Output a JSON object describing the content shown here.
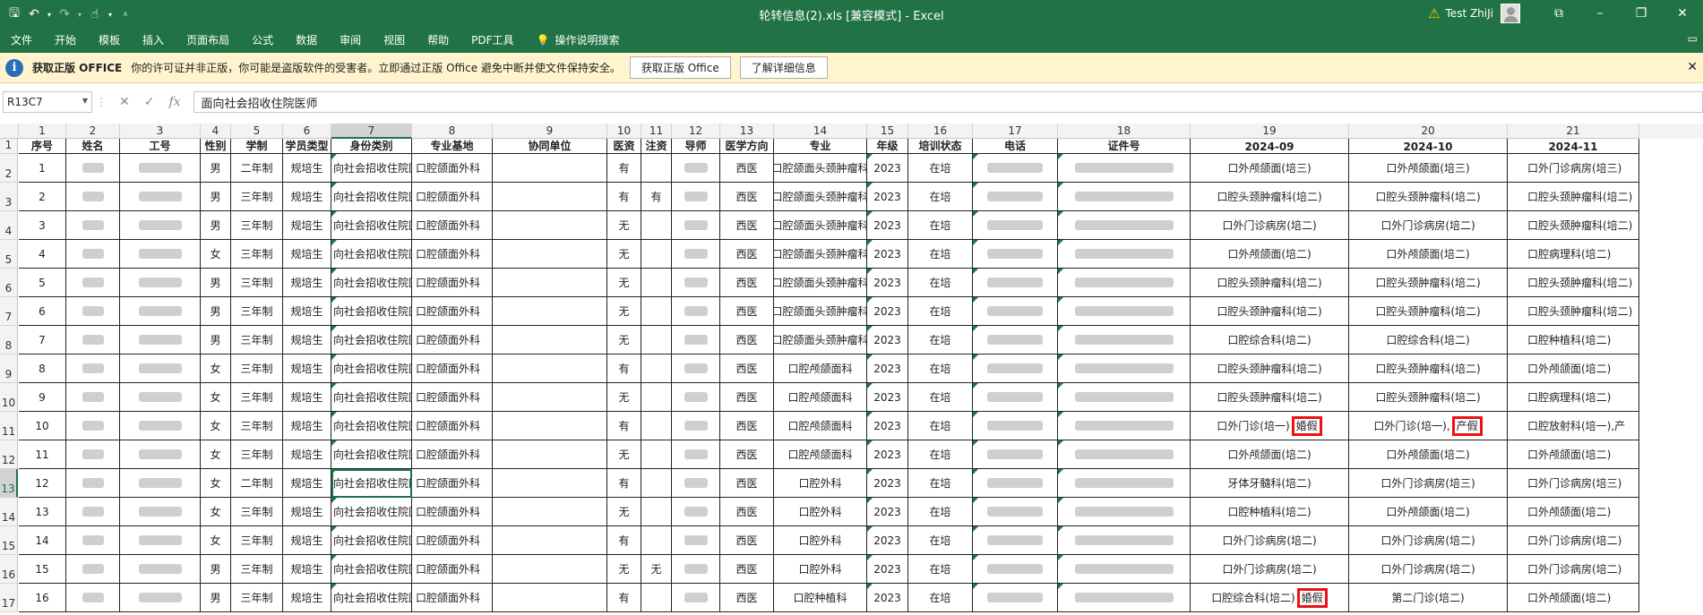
{
  "app": {
    "title": "轮转信息(2).xls  [兼容模式]  -  Excel",
    "user": "Test ZhiJi"
  },
  "ribbon": {
    "tabs": [
      "文件",
      "开始",
      "模板",
      "插入",
      "页面布局",
      "公式",
      "数据",
      "审阅",
      "视图",
      "帮助",
      "PDF工具"
    ],
    "tell_me": "操作说明搜索"
  },
  "message_bar": {
    "title": "获取正版 OFFICE",
    "text": "你的许可证并非正版，你可能是盗版软件的受害者。立即通过正版 Office 避免中断并使文件保持安全。",
    "button1": "获取正版 Office",
    "button2": "了解详细信息"
  },
  "formula_bar": {
    "name_box": "R13C7",
    "formula": "面向社会招收住院医师"
  },
  "sheet": {
    "column_numbers": [
      "1",
      "2",
      "3",
      "4",
      "5",
      "6",
      "7",
      "8",
      "9",
      "10",
      "11",
      "12",
      "13",
      "14",
      "15",
      "16",
      "17",
      "18",
      "19",
      "20",
      "21"
    ],
    "selected_column": "7",
    "selected_row": "13",
    "headers": [
      "序号",
      "姓名",
      "工号",
      "性别",
      "学制",
      "学员类型",
      "身份类别",
      "专业基地",
      "协同单位",
      "医资",
      "注资",
      "导师",
      "医学方向",
      "专业",
      "年级",
      "培训状态",
      "电话",
      "证件号",
      "2024-09",
      "2024-10",
      "2024-11"
    ],
    "row_numbers": [
      "1",
      "2",
      "3",
      "4",
      "5",
      "6",
      "7",
      "8",
      "9",
      "10",
      "11",
      "12",
      "13",
      "14",
      "15",
      "16",
      "17"
    ],
    "rows": [
      {
        "seq": "1",
        "sex": "男",
        "xz": "二年制",
        "type": "规培生",
        "cat": "向社会招收住院医",
        "base": "口腔颌面外科",
        "yz": "有",
        "zz": "",
        "dir": "西医",
        "major": "口腔颌面头颈肿瘤科",
        "grade": "2023",
        "status": "在培",
        "m1": "口外颅颌面(培三)",
        "m2": "口外颅颌面(培三)",
        "m3": "口外门诊病房(培三)"
      },
      {
        "seq": "2",
        "sex": "男",
        "xz": "三年制",
        "type": "规培生",
        "cat": "向社会招收住院医",
        "base": "口腔颌面外科",
        "yz": "有",
        "zz": "有",
        "dir": "西医",
        "major": "口腔颌面头颈肿瘤科",
        "grade": "2023",
        "status": "在培",
        "m1": "口腔头颈肿瘤科(培二)",
        "m2": "口腔头颈肿瘤科(培二)",
        "m3": "口腔头颈肿瘤科(培二)"
      },
      {
        "seq": "3",
        "sex": "男",
        "xz": "三年制",
        "type": "规培生",
        "cat": "向社会招收住院医",
        "base": "口腔颌面外科",
        "yz": "无",
        "zz": "",
        "dir": "西医",
        "major": "口腔颌面头颈肿瘤科",
        "grade": "2023",
        "status": "在培",
        "m1": "口外门诊病房(培二)",
        "m2": "口外门诊病房(培二)",
        "m3": "口腔头颈肿瘤科(培二)"
      },
      {
        "seq": "4",
        "sex": "女",
        "xz": "三年制",
        "type": "规培生",
        "cat": "向社会招收住院医",
        "base": "口腔颌面外科",
        "yz": "无",
        "zz": "",
        "dir": "西医",
        "major": "口腔颌面头颈肿瘤科",
        "grade": "2023",
        "status": "在培",
        "m1": "口外颅颌面(培二)",
        "m2": "口外颅颌面(培二)",
        "m3": "口腔病理科(培二)"
      },
      {
        "seq": "5",
        "sex": "男",
        "xz": "三年制",
        "type": "规培生",
        "cat": "向社会招收住院医",
        "base": "口腔颌面外科",
        "yz": "无",
        "zz": "",
        "dir": "西医",
        "major": "口腔颌面头颈肿瘤科",
        "grade": "2023",
        "status": "在培",
        "m1": "口腔头颈肿瘤科(培二)",
        "m2": "口腔头颈肿瘤科(培二)",
        "m3": "口腔头颈肿瘤科(培二)"
      },
      {
        "seq": "6",
        "sex": "男",
        "xz": "三年制",
        "type": "规培生",
        "cat": "向社会招收住院医",
        "base": "口腔颌面外科",
        "yz": "无",
        "zz": "",
        "dir": "西医",
        "major": "口腔颌面头颈肿瘤科",
        "grade": "2023",
        "status": "在培",
        "m1": "口腔头颈肿瘤科(培二)",
        "m2": "口腔头颈肿瘤科(培二)",
        "m3": "口腔头颈肿瘤科(培二)"
      },
      {
        "seq": "7",
        "sex": "男",
        "xz": "三年制",
        "type": "规培生",
        "cat": "向社会招收住院医",
        "base": "口腔颌面外科",
        "yz": "无",
        "zz": "",
        "dir": "西医",
        "major": "口腔颌面头颈肿瘤科",
        "grade": "2023",
        "status": "在培",
        "m1": "口腔综合科(培二)",
        "m2": "口腔综合科(培二)",
        "m3": "口腔种植科(培二)"
      },
      {
        "seq": "8",
        "sex": "女",
        "xz": "三年制",
        "type": "规培生",
        "cat": "向社会招收住院医",
        "base": "口腔颌面外科",
        "yz": "有",
        "zz": "",
        "dir": "西医",
        "major": "口腔颅颌面科",
        "grade": "2023",
        "status": "在培",
        "m1": "口腔头颈肿瘤科(培二)",
        "m2": "口腔头颈肿瘤科(培二)",
        "m3": "口外颅颌面(培二)"
      },
      {
        "seq": "9",
        "sex": "女",
        "xz": "三年制",
        "type": "规培生",
        "cat": "向社会招收住院医",
        "base": "口腔颌面外科",
        "yz": "无",
        "zz": "",
        "dir": "西医",
        "major": "口腔颅颌面科",
        "grade": "2023",
        "status": "在培",
        "m1": "口腔头颈肿瘤科(培二)",
        "m2": "口腔头颈肿瘤科(培二)",
        "m3": "口腔病理科(培二)"
      },
      {
        "seq": "10",
        "sex": "女",
        "xz": "三年制",
        "type": "规培生",
        "cat": "向社会招收住院医",
        "base": "口腔颌面外科",
        "yz": "有",
        "zz": "",
        "dir": "西医",
        "major": "口腔颅颌面科",
        "grade": "2023",
        "status": "在培",
        "m1": "口外门诊(培一)",
        "m1_tag": "婚假",
        "m2": "口外门诊(培一),",
        "m2_tag": "产假",
        "m3": "口腔放射科(培一),产"
      },
      {
        "seq": "11",
        "sex": "女",
        "xz": "三年制",
        "type": "规培生",
        "cat": "向社会招收住院医",
        "base": "口腔颌面外科",
        "yz": "无",
        "zz": "",
        "dir": "西医",
        "major": "口腔颅颌面科",
        "grade": "2023",
        "status": "在培",
        "m1": "口外颅颌面(培二)",
        "m2": "口外颅颌面(培二)",
        "m3": "口外颅颌面(培二)"
      },
      {
        "seq": "12",
        "sex": "女",
        "xz": "二年制",
        "type": "规培生",
        "cat": "向社会招收住院医",
        "base": "口腔颌面外科",
        "yz": "有",
        "zz": "",
        "dir": "西医",
        "major": "口腔外科",
        "grade": "2023",
        "status": "在培",
        "m1": "牙体牙髓科(培二)",
        "m2": "口外门诊病房(培三)",
        "m3": "口外门诊病房(培三)"
      },
      {
        "seq": "13",
        "sex": "女",
        "xz": "三年制",
        "type": "规培生",
        "cat": "向社会招收住院医",
        "base": "口腔颌面外科",
        "yz": "无",
        "zz": "",
        "dir": "西医",
        "major": "口腔外科",
        "grade": "2023",
        "status": "在培",
        "m1": "口腔种植科(培二)",
        "m2": "口外颅颌面(培二)",
        "m3": "口外颅颌面(培二)"
      },
      {
        "seq": "14",
        "sex": "女",
        "xz": "三年制",
        "type": "规培生",
        "cat": "向社会招收住院医",
        "base": "口腔颌面外科",
        "yz": "有",
        "zz": "",
        "dir": "西医",
        "major": "口腔外科",
        "grade": "2023",
        "status": "在培",
        "m1": "口外门诊病房(培二)",
        "m2": "口外门诊病房(培二)",
        "m3": "口外门诊病房(培二)"
      },
      {
        "seq": "15",
        "sex": "男",
        "xz": "三年制",
        "type": "规培生",
        "cat": "向社会招收住院医",
        "base": "口腔颌面外科",
        "yz": "无",
        "zz": "无",
        "dir": "西医",
        "major": "口腔外科",
        "grade": "2023",
        "status": "在培",
        "m1": "口外门诊病房(培二)",
        "m2": "口外门诊病房(培二)",
        "m3": "口外门诊病房(培二)"
      },
      {
        "seq": "16",
        "sex": "男",
        "xz": "三年制",
        "type": "规培生",
        "cat": "向社会招收住院医",
        "base": "口腔颌面外科",
        "yz": "有",
        "zz": "",
        "dir": "西医",
        "major": "口腔种植科",
        "grade": "2023",
        "status": "在培",
        "m1": "口腔综合科(培二)",
        "m1_tag": "婚假",
        "m2": "第二门诊(培二)",
        "m3": "口外颅颌面(培二)"
      }
    ]
  }
}
